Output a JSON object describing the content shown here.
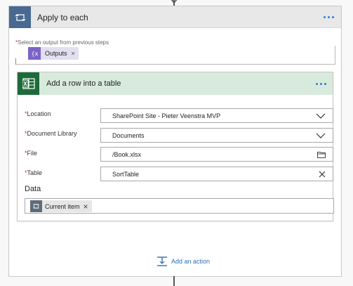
{
  "apply_to_each": {
    "title": "Apply to each",
    "select_label_required": "*",
    "select_label": "Select an output from previous steps",
    "token_label": "Outputs",
    "token_close": "×"
  },
  "excel_action": {
    "title": "Add a row into a table",
    "fields": [
      {
        "label": "Location",
        "value": "SharePoint Site - Pieter Veenstra MVP",
        "suffix": "chevron-down-icon"
      },
      {
        "label": "Document Library",
        "value": "Documents",
        "suffix": "chevron-down-icon"
      },
      {
        "label": "File",
        "value": "/Book.xlsx",
        "suffix": "folder-icon"
      },
      {
        "label": "Table",
        "value": "SortTable",
        "suffix": "close-icon"
      }
    ],
    "required_marker": "*",
    "data_label": "Data",
    "data_token_label": "Current item",
    "data_token_close": "×"
  },
  "add_action": {
    "label": "Add an action"
  },
  "colors": {
    "loop_icon_bg": "#486991",
    "excel_icon_bg": "#1d6b3a",
    "excel_header_bg": "#d8eadc",
    "outputs_token_icon": "#7b64c7",
    "link_blue": "#2f6fb4"
  }
}
